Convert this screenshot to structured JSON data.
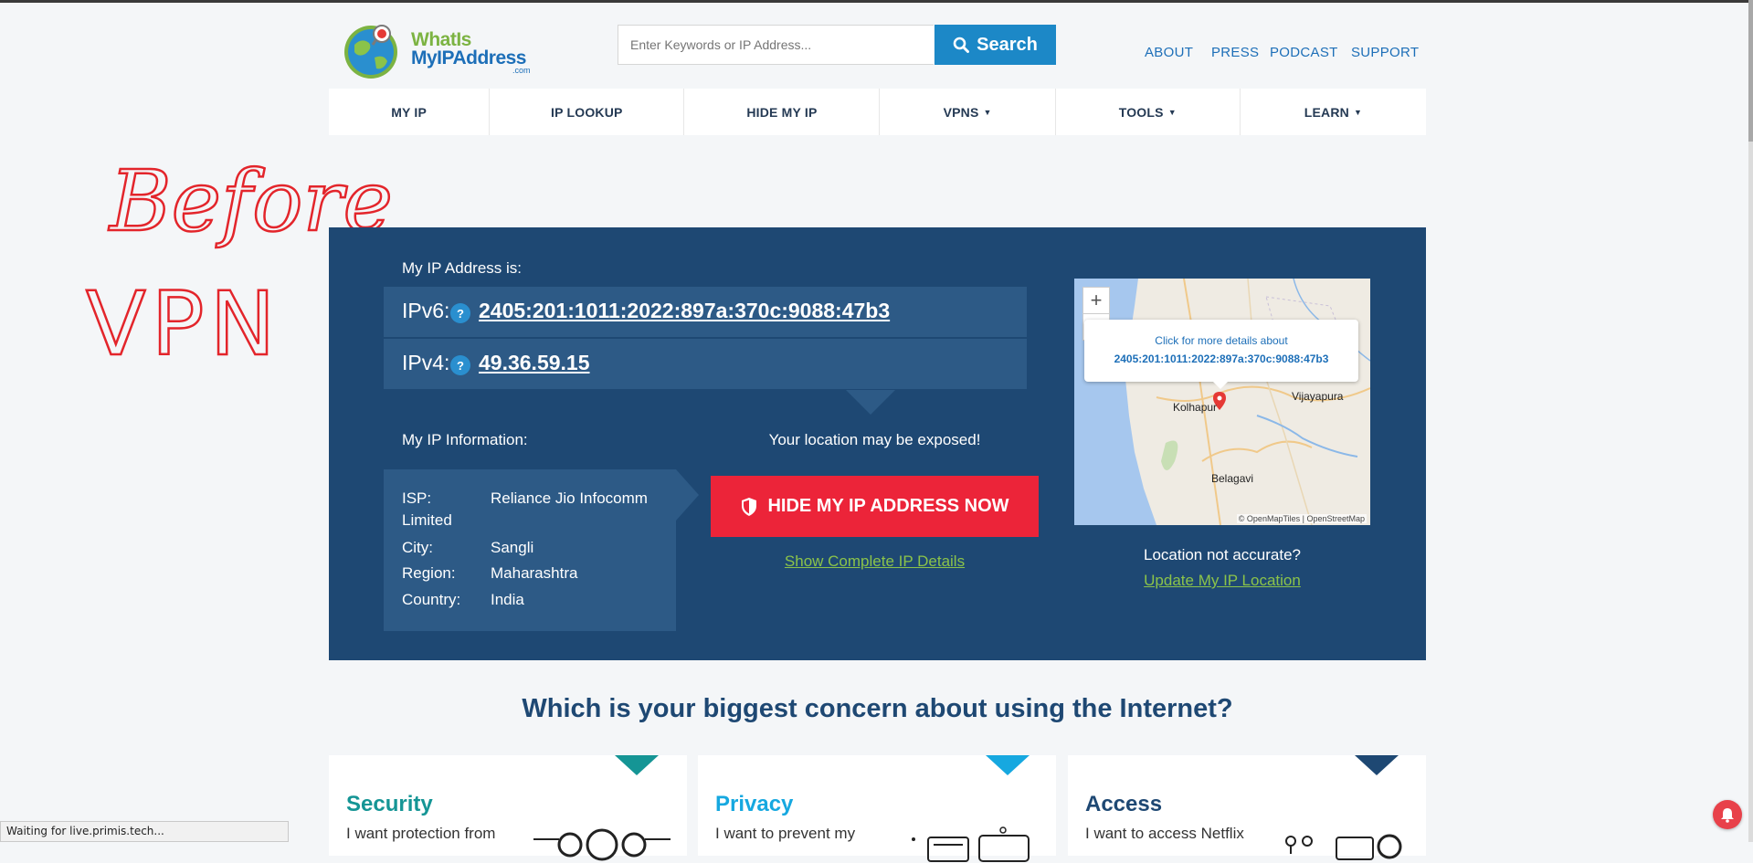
{
  "header": {
    "logo": {
      "line1": "WhatIs",
      "line2": "MyIPAddress",
      "line3": ".com"
    },
    "search_placeholder": "Enter Keywords or IP Address...",
    "search_button": "Search",
    "links": [
      "ABOUT",
      "PRESS",
      "PODCAST",
      "SUPPORT"
    ]
  },
  "nav": [
    "MY IP",
    "IP LOOKUP",
    "HIDE MY IP",
    "VPNS",
    "TOOLS",
    "LEARN"
  ],
  "annotation": {
    "line1": "Before",
    "line2": "VPN"
  },
  "hero": {
    "my_ip_label": "My IP Address is:",
    "ipv6_label": "IPv6:",
    "ipv6_value": "2405:201:1011:2022:897a:370c:9088:47b3",
    "ipv4_label": "IPv4:",
    "ipv4_value": "49.36.59.15",
    "help_glyph": "?",
    "info_label": "My IP Information:",
    "isp_label": "ISP:",
    "isp_value": "Reliance Jio Infocomm",
    "isp_value_cont": "Limited",
    "city_label": "City:",
    "city_value": "Sangli",
    "region_label": "Region:",
    "region_value": "Maharashtra",
    "country_label": "Country:",
    "country_value": "India",
    "exposed_text": "Your location may be exposed!",
    "hide_button": "HIDE MY IP ADDRESS NOW",
    "show_details": "Show Complete IP Details",
    "location_question": "Location not accurate?",
    "update_location": "Update My IP Location"
  },
  "map": {
    "zoom_in": "+",
    "zoom_out": "−",
    "popup_line1": "Click for more details about",
    "popup_line2": "2405:201:1011:2022:897a:370c:9088:47b3",
    "cities": [
      "Kolhapur",
      "Vijayapura",
      "Belagavi"
    ],
    "attribution": "© OpenMapTiles | OpenStreetMap"
  },
  "concern": {
    "heading": "Which is your biggest concern about using the Internet?",
    "cards": [
      {
        "title": "Security",
        "text": "I want protection from",
        "color": "#159595"
      },
      {
        "title": "Privacy",
        "text": "I want to prevent my",
        "color": "#16a8e0"
      },
      {
        "title": "Access",
        "text": "I want to access Netflix",
        "color": "#1e4873"
      }
    ]
  },
  "status_bar": "Waiting for live.primis.tech..."
}
